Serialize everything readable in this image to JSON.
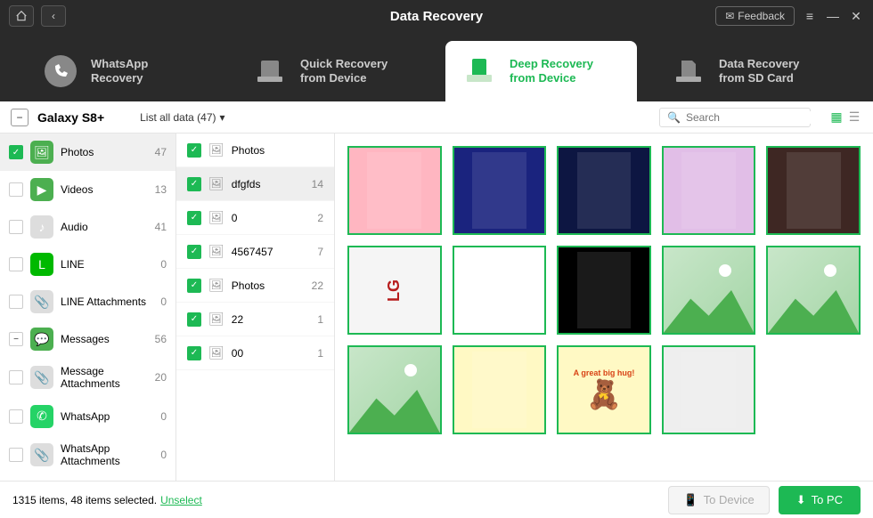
{
  "header": {
    "title": "Data Recovery",
    "feedback": "Feedback"
  },
  "tabs": [
    {
      "line1": "WhatsApp",
      "line2": "Recovery"
    },
    {
      "line1": "Quick Recovery",
      "line2": "from Device"
    },
    {
      "line1": "Deep Recovery",
      "line2": "from Device"
    },
    {
      "line1": "Data Recovery",
      "line2": "from SD Card"
    }
  ],
  "toolbar": {
    "device": "Galaxy S8+",
    "filter": "List all data (47)",
    "search_placeholder": "Search"
  },
  "categories": [
    {
      "label": "Photos",
      "count": 47,
      "icon": "🖼",
      "bg": "#4caf50",
      "checked": "checked",
      "selected": true
    },
    {
      "label": "Videos",
      "count": 13,
      "icon": "▶",
      "bg": "#4caf50",
      "checked": "none"
    },
    {
      "label": "Audio",
      "count": 41,
      "icon": "♪",
      "bg": "#ddd",
      "checked": "none"
    },
    {
      "label": "LINE",
      "count": 0,
      "icon": "L",
      "bg": "#00b900",
      "checked": "none"
    },
    {
      "label": "LINE Attachments",
      "count": 0,
      "icon": "📎",
      "bg": "#ddd",
      "checked": "none"
    },
    {
      "label": "Messages",
      "count": 56,
      "icon": "💬",
      "bg": "#4caf50",
      "checked": "partial"
    },
    {
      "label": "Message Attachments",
      "count": 20,
      "icon": "📎",
      "bg": "#ddd",
      "checked": "none"
    },
    {
      "label": "WhatsApp",
      "count": 0,
      "icon": "✆",
      "bg": "#25d366",
      "checked": "none"
    },
    {
      "label": "WhatsApp Attachments",
      "count": 0,
      "icon": "📎",
      "bg": "#ddd",
      "checked": "none"
    }
  ],
  "sublist": [
    {
      "label": "Photos",
      "count": "",
      "selected": false
    },
    {
      "label": "dfgfds",
      "count": 14,
      "selected": true
    },
    {
      "label": "0",
      "count": 2,
      "selected": false
    },
    {
      "label": "4567457",
      "count": 7,
      "selected": false
    },
    {
      "label": "Photos",
      "count": 22,
      "selected": false
    },
    {
      "label": "22",
      "count": 1,
      "selected": false
    },
    {
      "label": "00",
      "count": 1,
      "selected": false
    }
  ],
  "thumbnails": [
    {
      "type": "image",
      "bg": "#ffb6c1"
    },
    {
      "type": "image",
      "bg": "#1a237e"
    },
    {
      "type": "image",
      "bg": "#0d1642"
    },
    {
      "type": "image",
      "bg": "#e1bee7"
    },
    {
      "type": "image",
      "bg": "#3e2723"
    },
    {
      "type": "lg",
      "text": "LG"
    },
    {
      "type": "image",
      "bg": "#ffffff"
    },
    {
      "type": "image",
      "bg": "#000000"
    },
    {
      "type": "placeholder"
    },
    {
      "type": "placeholder"
    },
    {
      "type": "placeholder"
    },
    {
      "type": "image",
      "bg": "#fff9c4"
    },
    {
      "type": "hug",
      "text": "A great big hug!",
      "bg": "#fff9c4"
    },
    {
      "type": "image",
      "bg": "#eeeeee"
    }
  ],
  "footer": {
    "status": "1315 items, 48 items selected.",
    "unselect": "Unselect",
    "to_device": "To Device",
    "to_pc": "To PC"
  }
}
